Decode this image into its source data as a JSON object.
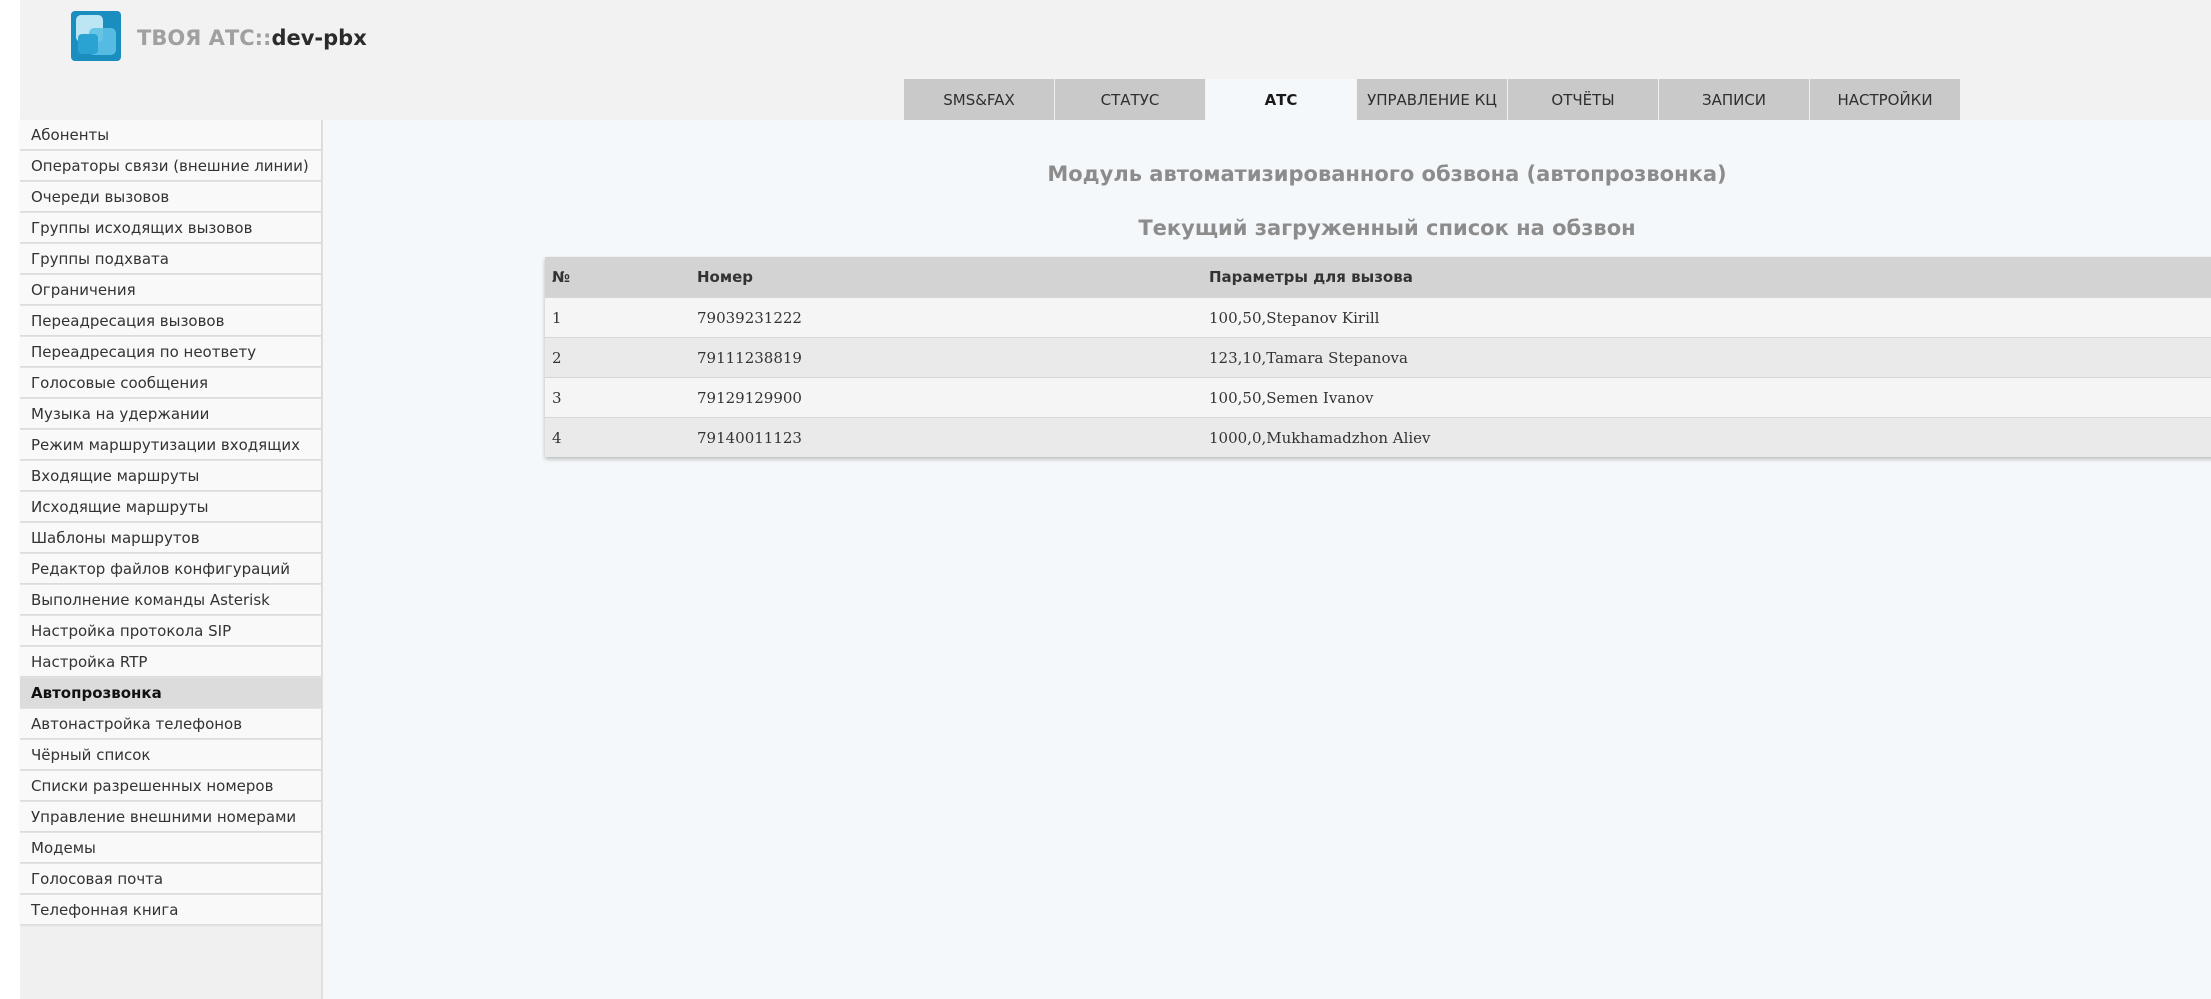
{
  "header": {
    "brand_prefix": "ТВОЯ АТС::",
    "brand_host": "dev-pbx",
    "logo_icon": "pbx-logo-icon",
    "logo_colors": [
      "#1a8fbf",
      "#5cc0e6",
      "#bde6f5"
    ]
  },
  "tabs": [
    {
      "label": "SMS&FAX",
      "active": false
    },
    {
      "label": "СТАТУС",
      "active": false
    },
    {
      "label": "АТС",
      "active": true
    },
    {
      "label": "УПРАВЛЕНИЕ КЦ",
      "active": false
    },
    {
      "label": "ОТЧЁТЫ",
      "active": false
    },
    {
      "label": "ЗАПИСИ",
      "active": false
    },
    {
      "label": "НАСТРОЙКИ",
      "active": false
    }
  ],
  "sidebar": {
    "items": [
      {
        "label": "Абоненты"
      },
      {
        "label": "Операторы связи (внешние линии)"
      },
      {
        "label": "Очереди вызовов"
      },
      {
        "label": "Группы исходящих вызовов"
      },
      {
        "label": "Группы подхвата"
      },
      {
        "label": "Ограничения"
      },
      {
        "label": "Переадресация вызовов"
      },
      {
        "label": "Переадресация по неответу"
      },
      {
        "label": "Голосовые сообщения"
      },
      {
        "label": "Музыка на удержании"
      },
      {
        "label": "Режим маршрутизации входящих"
      },
      {
        "label": "Входящие маршруты"
      },
      {
        "label": "Исходящие маршруты"
      },
      {
        "label": "Шаблоны маршрутов"
      },
      {
        "label": "Редактор файлов конфигураций"
      },
      {
        "label": "Выполнение команды Asterisk"
      },
      {
        "label": "Настройка протокола SIP"
      },
      {
        "label": "Настройка RTP"
      },
      {
        "label": "Автопрозвонка",
        "active": true
      },
      {
        "label": "Автонастройка телефонов"
      },
      {
        "label": "Чёрный список"
      },
      {
        "label": "Списки разрешенных номеров"
      },
      {
        "label": "Управление внешними номерами"
      },
      {
        "label": "Модемы"
      },
      {
        "label": "Голосовая почта"
      },
      {
        "label": "Телефонная книга"
      }
    ]
  },
  "main": {
    "module_title": "Модуль автоматизированного обзвона (автопрозвонка)",
    "list_title": "Текущий загруженный список на обзвон",
    "table": {
      "headers": {
        "num": "№",
        "phone": "Номер",
        "params": "Параметры для вызова"
      },
      "rows": [
        {
          "num": "1",
          "phone": "79039231222",
          "params": "100,50,Stepanov Kirill"
        },
        {
          "num": "2",
          "phone": "79111238819",
          "params": "123,10,Tamara Stepanova"
        },
        {
          "num": "3",
          "phone": "79129129900",
          "params": "100,50,Semen Ivanov"
        },
        {
          "num": "4",
          "phone": "79140011123",
          "params": "1000,0,Mukhamadzhon Aliev"
        }
      ]
    }
  }
}
